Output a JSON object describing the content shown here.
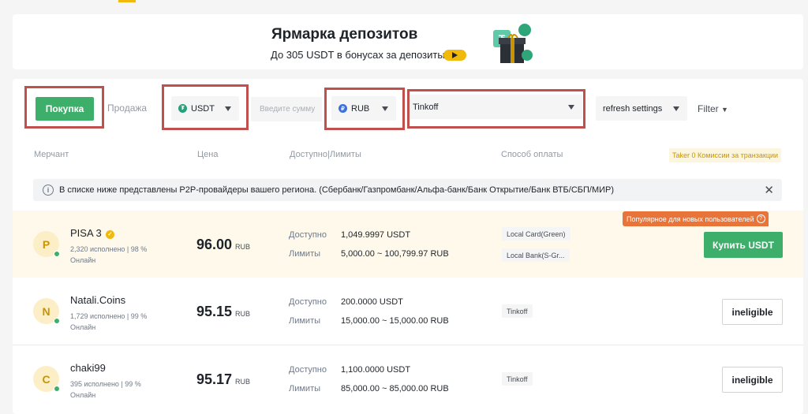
{
  "banner": {
    "title": "Ярмарка депозитов",
    "subtitle": "До 305 USDT в бонусах за депозиты"
  },
  "filters": {
    "buy_label": "Покупка",
    "sell_label": "Продажа",
    "asset": "USDT",
    "amount_placeholder": "Введите сумму",
    "fiat": "RUB",
    "payment": "Tinkoff",
    "refresh": "refresh settings",
    "filter_label": "Filter"
  },
  "table_header": {
    "merchant": "Мерчант",
    "price": "Цена",
    "available": "Доступно|Лимиты",
    "payment": "Способ оплаты",
    "taker": "Taker 0 Комиссии за транзакции"
  },
  "notice": "В списке ниже представлены P2P-провайдеры вашего региона. (Сбербанк/Газпромбанк/Альфа-банк/Банк Открытие/Банк ВТБ/СБП/МИР)",
  "labels": {
    "available": "Доступно",
    "limits": "Лимиты",
    "price_unit": "RUB",
    "online": "Онлайн",
    "popular": "Популярное для новых пользователей"
  },
  "rows": [
    {
      "initial": "P",
      "name": "PISA 3",
      "stats": "2,320 исполнено  |  98 %",
      "price": "96.00",
      "available": "1,049.9997 USDT",
      "limits": "5,000.00 ~ 100,799.97 RUB",
      "payments": [
        "Local Card(Green)",
        "Local Bank(S-Gr..."
      ],
      "action": "Купить USDT"
    },
    {
      "initial": "N",
      "name": "Natali.Coins",
      "stats": "1,729 исполнено  |  99 %",
      "price": "95.15",
      "available": "200.0000 USDT",
      "limits": "15,000.00 ~ 15,000.00 RUB",
      "payments": [
        "Tinkoff"
      ],
      "action": "ineligible"
    },
    {
      "initial": "C",
      "name": "chaki99",
      "stats": "395 исполнено  |  99 %",
      "price": "95.17",
      "available": "1,100.0000 USDT",
      "limits": "85,000.00 ~ 85,000.00 RUB",
      "payments": [
        "Tinkoff"
      ],
      "action": "ineligible"
    }
  ],
  "colors": {
    "accent": "#f0b90b",
    "buy_green": "#3daf6a",
    "highlight_box": "#c0504d",
    "popular_orange": "#e9743a"
  }
}
